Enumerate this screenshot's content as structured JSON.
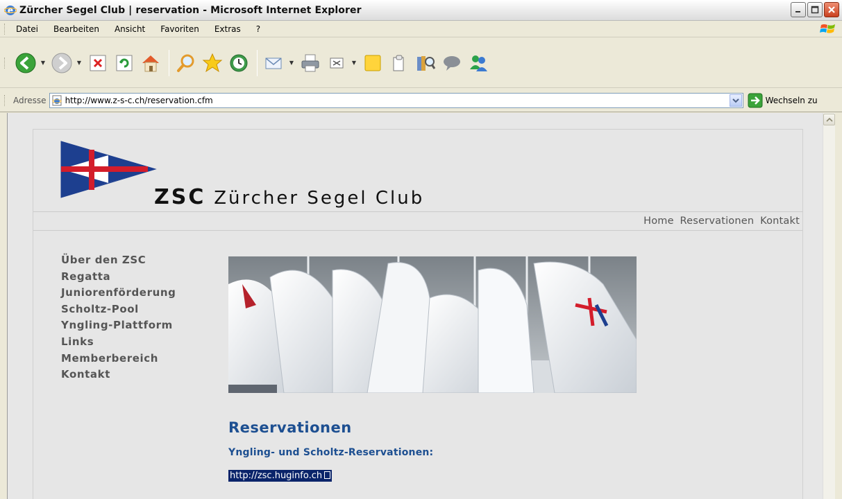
{
  "window": {
    "title": "Zürcher Segel Club | reservation - Microsoft Internet Explorer"
  },
  "menu": {
    "items": [
      "Datei",
      "Bearbeiten",
      "Ansicht",
      "Favoriten",
      "Extras",
      "?"
    ]
  },
  "address": {
    "label": "Adresse",
    "url": "http://www.z-s-c.ch/reservation.cfm",
    "go_label": "Wechseln zu"
  },
  "site": {
    "brand_short": "ZSC",
    "brand_name": "Zürcher Segel Club",
    "topnav": [
      "Home",
      "Reservationen",
      "Kontakt"
    ],
    "sidebar": [
      "Über den ZSC",
      "Regatta",
      "Juniorenförderung",
      "Scholtz-Pool",
      "Yngling-Plattform",
      "Links",
      "Memberbereich",
      "Kontakt"
    ]
  },
  "content": {
    "heading": "Reservationen",
    "subheading": "Yngling- und Scholtz-Reservationen:",
    "link_text": "http://zsc.huginfo.ch"
  },
  "colors": {
    "heading_blue": "#1d4f91",
    "selection": "#0a246a",
    "pennant_blue": "#1d3f8f",
    "pennant_red": "#d31d2b"
  }
}
